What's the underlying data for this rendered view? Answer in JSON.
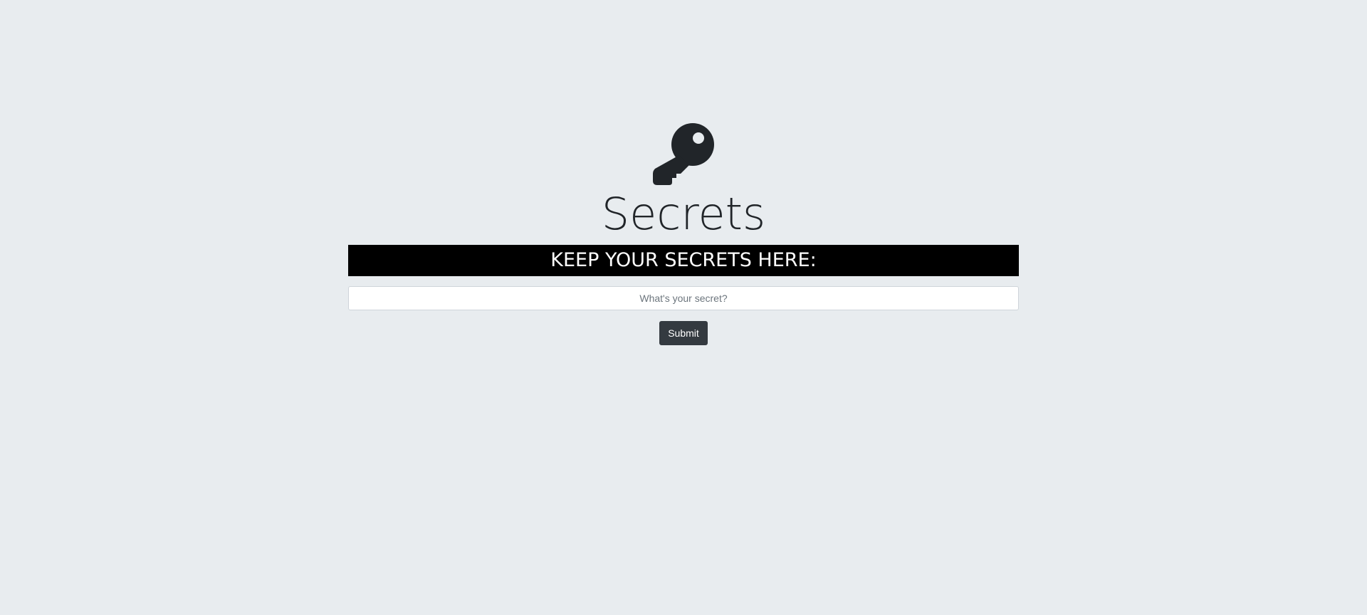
{
  "header": {
    "icon": "key-icon",
    "title": "Secrets"
  },
  "banner": {
    "text": "KEEP YOUR SECRETS HERE:"
  },
  "form": {
    "secret_value": "",
    "secret_placeholder": "What's your secret?",
    "submit_label": "Submit"
  },
  "colors": {
    "background": "#e8ecef",
    "text": "#212529",
    "banner_bg": "#000000",
    "banner_text": "#ffffff",
    "button_bg": "#343a40"
  }
}
